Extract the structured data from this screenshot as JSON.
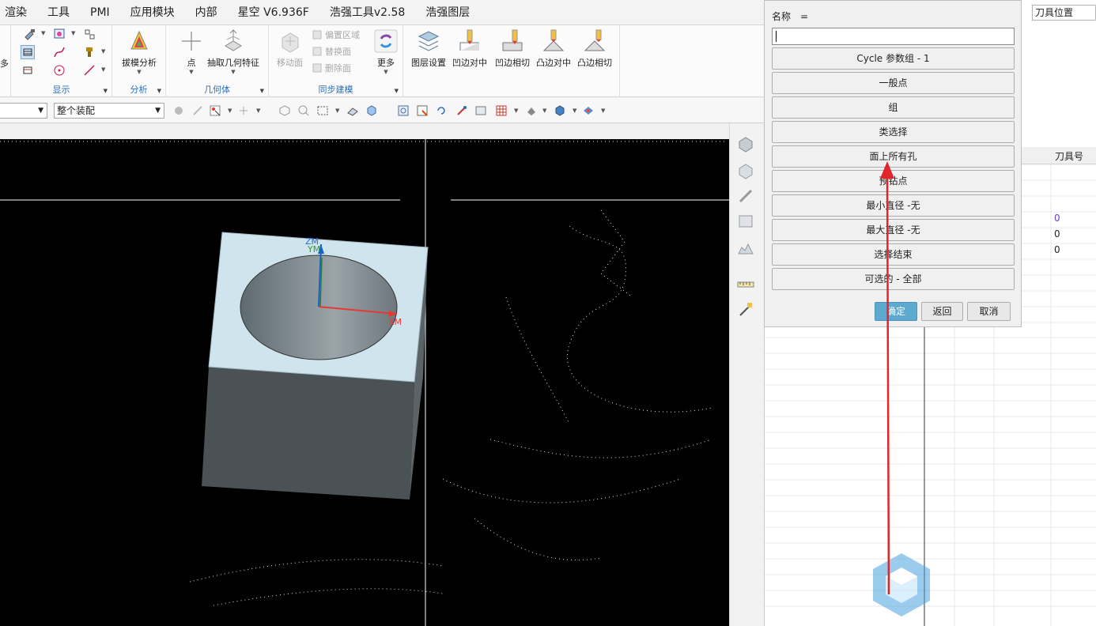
{
  "menu": [
    "渲染",
    "工具",
    "PMI",
    "应用模块",
    "内部",
    "星空 V6.936F",
    "浩强工具v2.58",
    "浩强图层"
  ],
  "ribbon": {
    "groups": {
      "display": "显示",
      "analysis": "分析",
      "geometry": "几何体",
      "sync": "同步建模"
    },
    "buttons": {
      "draft_analysis": "拔模分析",
      "point": "点",
      "extract_geometry": "抽取几何特征",
      "move_face": "移动面",
      "offset_region": "偏置区域",
      "replace_face": "替换面",
      "delete_face": "删除面",
      "more": "更多",
      "layer_settings": "图层设置",
      "concave_center": "凹边对中",
      "concave_tangent": "凹边相切",
      "convex_center": "凸边对中",
      "convex_tangent": "凸边相切"
    },
    "left_fragment": "多"
  },
  "toolbar2": {
    "assembly_select": "整个装配"
  },
  "viewport": {
    "axes": {
      "zm": "ZM",
      "ym": "YM",
      "xm": "XM"
    }
  },
  "right_panel": {
    "tool_position": "刀具位置",
    "column_header": "刀具号",
    "values": [
      "0",
      "0",
      "0"
    ]
  },
  "dialog": {
    "name_label": "名称　=",
    "name_value": "",
    "options": [
      "Cycle 参数组 - 1",
      "一般点",
      "组",
      "类选择",
      "面上所有孔",
      "预钻点",
      "最小直径 -无",
      "最大直径 -无",
      "选择结束",
      "可选的 - 全部"
    ],
    "ok": "确定",
    "back": "返回",
    "cancel": "取消"
  },
  "colors": {
    "accent": "#2a6ebb",
    "ok_button": "#5ea9cf",
    "arrow": "#e0252b",
    "viewport_bg": "#000000"
  }
}
